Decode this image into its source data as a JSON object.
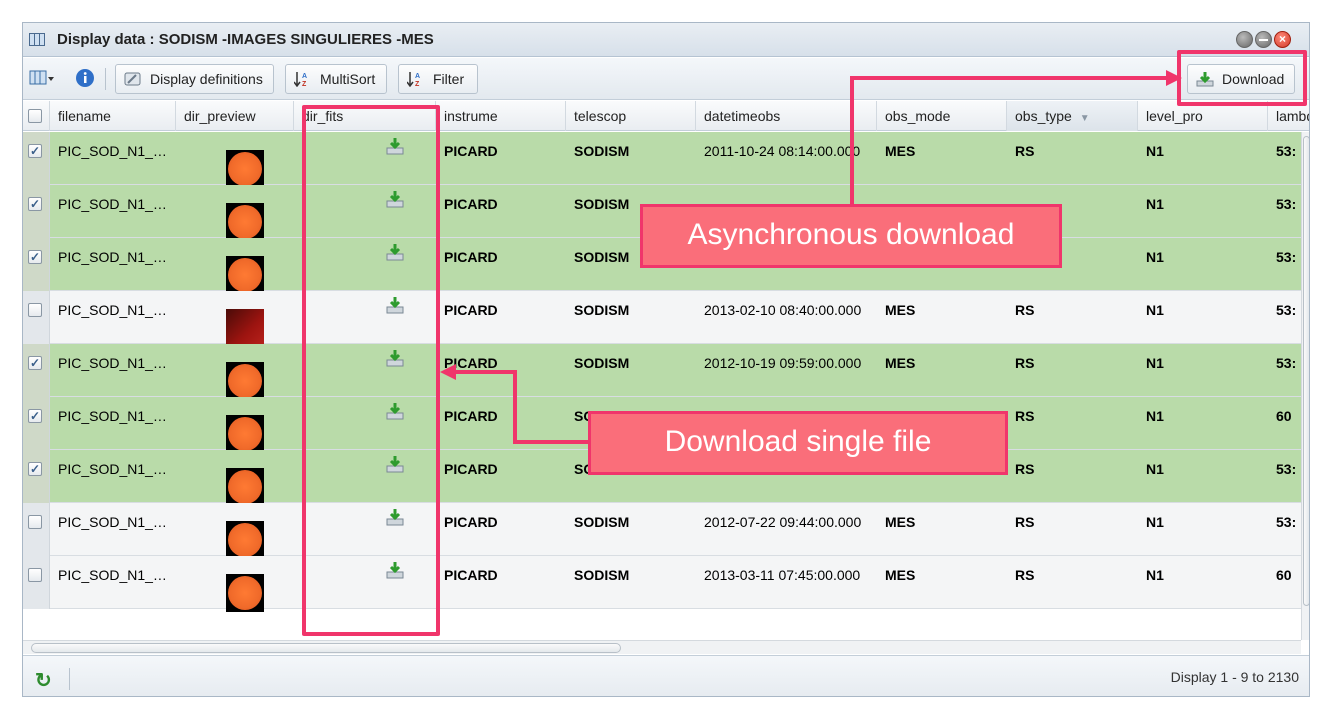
{
  "window": {
    "title": "Display data : SODISM -IMAGES SINGULIERES -MES"
  },
  "toolbar": {
    "display_definitions": "Display definitions",
    "multisort": "MultiSort",
    "filter": "Filter",
    "download": "Download"
  },
  "columns": [
    "filename",
    "dir_preview",
    "dir_fits",
    "instrume",
    "telescop",
    "datetimeobs",
    "obs_mode",
    "obs_type",
    "level_pro",
    "lambd"
  ],
  "rows": [
    {
      "checked": "✓",
      "filename": "PIC_SOD_N1_…",
      "instrume": "PICARD",
      "telescop": "SODISM",
      "datetimeobs": "2011-10-24 08:14:00.000",
      "obs_mode": "MES",
      "obs_type": "RS",
      "level_pro": "N1",
      "lambda": "53:"
    },
    {
      "checked": "✓",
      "filename": "PIC_SOD_N1_…",
      "instrume": "PICARD",
      "telescop": "SODISM",
      "datetimeobs": "",
      "obs_mode": "",
      "obs_type": "",
      "level_pro": "N1",
      "lambda": "53:"
    },
    {
      "checked": "✓",
      "filename": "PIC_SOD_N1_…",
      "instrume": "PICARD",
      "telescop": "SODISM",
      "datetimeobs": "",
      "obs_mode": "",
      "obs_type": "",
      "level_pro": "N1",
      "lambda": "53:"
    },
    {
      "checked": "",
      "filename": "PIC_SOD_N1_…",
      "instrume": "PICARD",
      "telescop": "SODISM",
      "datetimeobs": "2013-02-10 08:40:00.000",
      "obs_mode": "MES",
      "obs_type": "RS",
      "level_pro": "N1",
      "lambda": "53:"
    },
    {
      "checked": "✓",
      "filename": "PIC_SOD_N1_…",
      "instrume": "PICARD",
      "telescop": "SODISM",
      "datetimeobs": "2012-10-19 09:59:00.000",
      "obs_mode": "MES",
      "obs_type": "RS",
      "level_pro": "N1",
      "lambda": "53:"
    },
    {
      "checked": "✓",
      "filename": "PIC_SOD_N1_…",
      "instrume": "PICARD",
      "telescop": "SC",
      "datetimeobs": "",
      "obs_mode": "",
      "obs_type": "RS",
      "level_pro": "N1",
      "lambda": "60"
    },
    {
      "checked": "✓",
      "filename": "PIC_SOD_N1_…",
      "instrume": "PICARD",
      "telescop": "SC",
      "datetimeobs": "",
      "obs_mode": "",
      "obs_type": "RS",
      "level_pro": "N1",
      "lambda": "53:"
    },
    {
      "checked": "",
      "filename": "PIC_SOD_N1_…",
      "instrume": "PICARD",
      "telescop": "SODISM",
      "datetimeobs": "2012-07-22 09:44:00.000",
      "obs_mode": "MES",
      "obs_type": "RS",
      "level_pro": "N1",
      "lambda": "53:"
    },
    {
      "checked": "",
      "filename": "PIC_SOD_N1_…",
      "instrume": "PICARD",
      "telescop": "SODISM",
      "datetimeobs": "2013-03-11 07:45:00.000",
      "obs_mode": "MES",
      "obs_type": "RS",
      "level_pro": "N1",
      "lambda": "60"
    }
  ],
  "previews": [
    "orange",
    "orange",
    "orange",
    "dark",
    "orange",
    "orange",
    "orange",
    "orange",
    "orange"
  ],
  "footer": {
    "pager": "Display 1 - 9 to 2130"
  },
  "annotations": {
    "async_download": "Asynchronous download",
    "single_download": "Download single file"
  },
  "colors": {
    "selected_row": "#b9dba9",
    "highlight": "#f0356b",
    "callout_fill": "#fa6e7a"
  }
}
